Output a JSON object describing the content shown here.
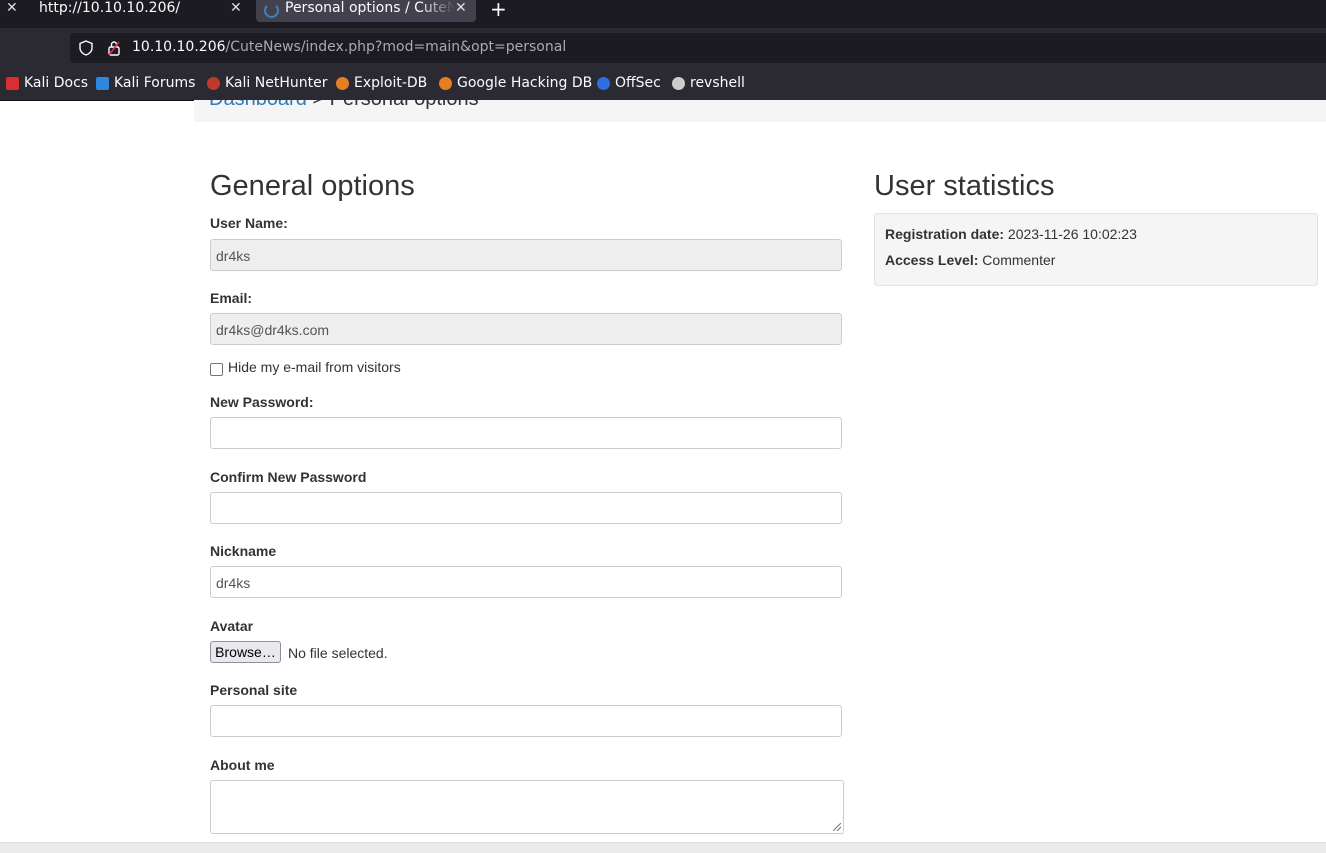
{
  "browser": {
    "tabs": [
      {
        "title": "http://10.10.10.206/"
      },
      {
        "title": "Personal options / CuteNews"
      }
    ],
    "url_host": "10.10.10.206",
    "url_path": "/CuteNews/index.php?mod=main&opt=personal",
    "bookmarks": [
      {
        "label": "Kali Docs",
        "color": "#d63031"
      },
      {
        "label": "Kali Forums",
        "color": "#2e86de"
      },
      {
        "label": "Kali NetHunter",
        "color": "#c0392b"
      },
      {
        "label": "Exploit-DB",
        "color": "#e67e22"
      },
      {
        "label": "Google Hacking DB",
        "color": "#e67e22"
      },
      {
        "label": "OffSec",
        "color": "#2d6ee0"
      },
      {
        "label": "revshell",
        "color": "#cccccc"
      }
    ]
  },
  "breadcrumb": {
    "root": "Dashboard",
    "separator": " > ",
    "current": "Personal options"
  },
  "general": {
    "title": "General options",
    "username_label": "User Name:",
    "username_value": "dr4ks",
    "email_label": "Email:",
    "email_value": "dr4ks@dr4ks.com",
    "hide_email_label": "Hide my e-mail from visitors",
    "new_password_label": "New Password:",
    "confirm_password_label": "Confirm New Password",
    "nickname_label": "Nickname",
    "nickname_value": "dr4ks",
    "avatar_label": "Avatar",
    "browse_label": "Browse…",
    "no_file_text": "No file selected.",
    "personal_site_label": "Personal site",
    "about_label": "About me"
  },
  "stats": {
    "title": "User statistics",
    "reg_label": "Registration date:",
    "reg_value": "2023-11-26 10:02:23",
    "access_label": "Access Level:",
    "access_value": "Commenter"
  }
}
